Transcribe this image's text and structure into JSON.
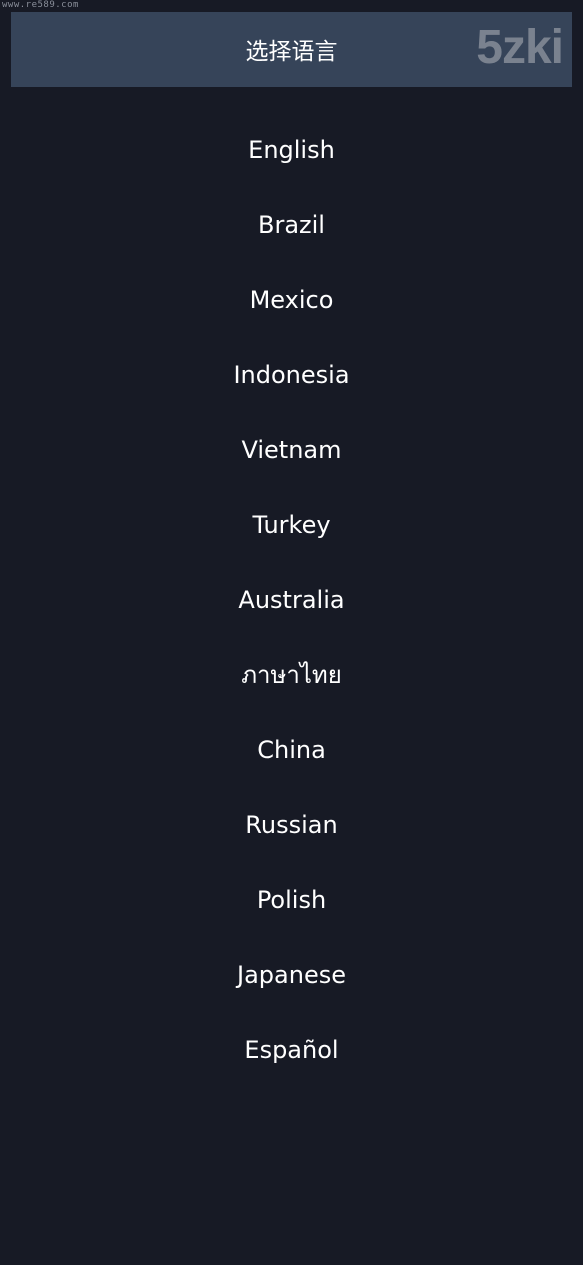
{
  "watermark": {
    "site": "www.re589.com",
    "logo": "5zki"
  },
  "header": {
    "title": "选择语言"
  },
  "languages": [
    "English",
    "Brazil",
    "Mexico",
    "Indonesia",
    "Vietnam",
    "Turkey",
    "Australia",
    "ภาษาไทย",
    "China",
    "Russian",
    "Polish",
    "Japanese",
    "Español"
  ],
  "colors": {
    "background": "#171a25",
    "header_bg": "#364459",
    "text": "#ffffff",
    "watermark": "#7a828f"
  }
}
